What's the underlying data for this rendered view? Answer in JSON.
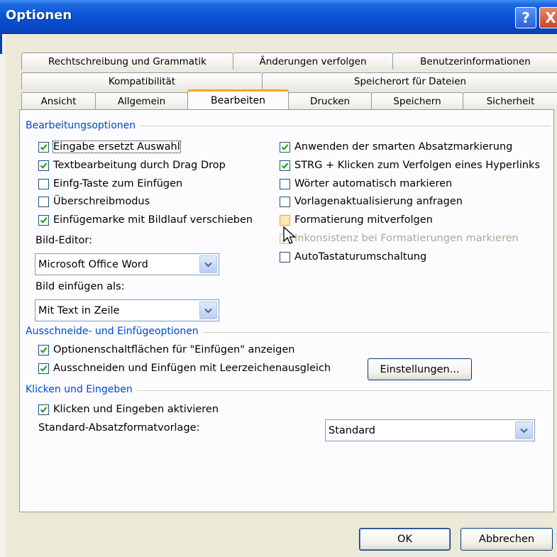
{
  "window": {
    "title": "Optionen",
    "help_label": "?",
    "close_label": "X"
  },
  "tabs_row1": [
    "Rechtschreibung und Grammatik",
    "Änderungen verfolgen",
    "Benutzerinformationen"
  ],
  "tabs_row2": [
    "Kompatibilität",
    "Speicherort für Dateien"
  ],
  "tabs_row3": [
    "Ansicht",
    "Allgemein",
    "Bearbeiten",
    "Drucken",
    "Speichern",
    "Sicherheit"
  ],
  "active_tab": "Bearbeiten",
  "groups": {
    "editing": "Bearbeitungsoptionen",
    "cutpaste": "Ausschneide- und Einfügeoptionen",
    "clicktype": "Klicken und Eingeben"
  },
  "editing_left": [
    {
      "label": "Eingabe ersetzt Auswahl",
      "checked": true
    },
    {
      "label": "Textbearbeitung durch Drag  Drop",
      "checked": true
    },
    {
      "label": "Einfg-Taste zum Einfügen",
      "checked": false
    },
    {
      "label": "Überschreibmodus",
      "checked": false
    },
    {
      "label": "Einfügemarke mit Bildlauf verschieben",
      "checked": true
    }
  ],
  "editing_right": [
    {
      "label": "Anwenden der smarten Absatzmarkierung",
      "checked": true
    },
    {
      "label": "STRG + Klicken zum Verfolgen eines Hyperlinks",
      "checked": true
    },
    {
      "label": "Wörter automatisch markieren",
      "checked": false
    },
    {
      "label": "Vorlagenaktualisierung anfragen",
      "checked": false
    },
    {
      "label": "Formatierung mitverfolgen",
      "checked": false
    },
    {
      "label": "Inkonsistenz bei Formatierungen markieren",
      "checked": false,
      "disabled": true
    },
    {
      "label": "AutoTastaturumschaltung",
      "checked": false
    }
  ],
  "picture_editor": {
    "label": "Bild-Editor:",
    "value": "Microsoft Office Word"
  },
  "insert_picture": {
    "label": "Bild einfügen als:",
    "value": "Mit Text in Zeile"
  },
  "cutpaste_options": [
    {
      "label": "Optionenschaltflächen für \"Einfügen\" anzeigen",
      "checked": true
    },
    {
      "label": "Ausschneiden und Einfügen mit Leerzeichenausgleich",
      "checked": true
    }
  ],
  "settings_button": "Einstellungen...",
  "clicktype_option": {
    "label": "Klicken und Eingeben aktivieren",
    "checked": true
  },
  "default_style": {
    "label": "Standard-Absatzformatvorlage:",
    "value": "Standard"
  },
  "footer": {
    "ok": "OK",
    "cancel": "Abbrechen"
  },
  "colors": {
    "title_bar": "#0a55d6",
    "dialog_bg": "#ece9d8",
    "group_text": "#0046d5",
    "tab_highlight": "#f5a623"
  }
}
